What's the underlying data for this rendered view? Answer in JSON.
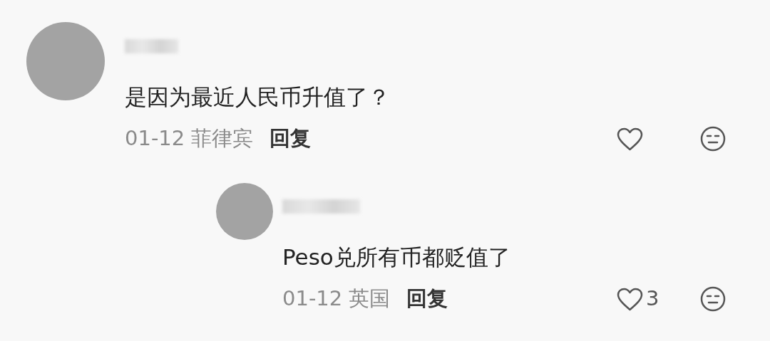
{
  "comments": [
    {
      "name_hidden": true,
      "text": "是因为最近人民币升值了？",
      "date": "01-12",
      "location": "菲律宾",
      "reply_label": "回复",
      "replies": [
        {
          "name_hidden": true,
          "text": "Peso兑所有币都贬值了",
          "date": "01-12",
          "location": "英国",
          "reply_label": "回复",
          "likes": "3"
        }
      ]
    }
  ]
}
